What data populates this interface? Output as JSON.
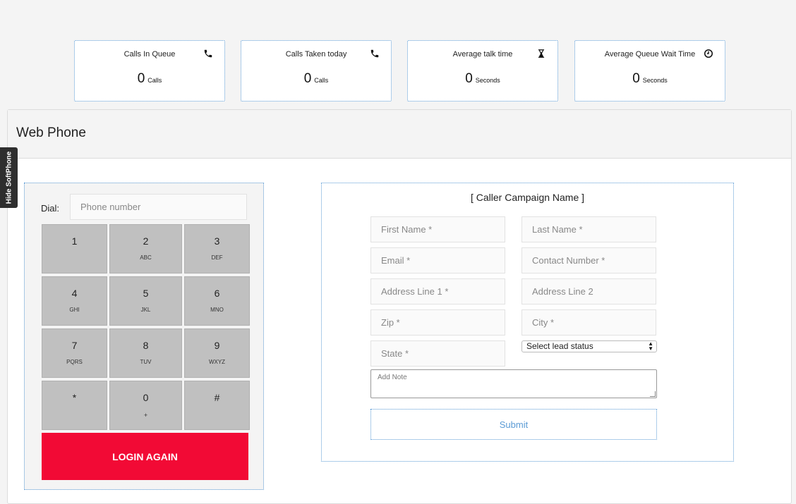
{
  "stats": [
    {
      "label": "Calls In Queue",
      "value": "0",
      "unit": "Calls",
      "icon": "phone-icon"
    },
    {
      "label": "Calls Taken today",
      "value": "0",
      "unit": "Calls",
      "icon": "phone-icon"
    },
    {
      "label": "Average talk time",
      "value": "0",
      "unit": "Seconds",
      "icon": "hourglass-icon"
    },
    {
      "label": "Average Queue Wait Time",
      "value": "0",
      "unit": "Seconds",
      "icon": "clock-icon"
    }
  ],
  "side_tab": {
    "label": "Hide SoftPhone"
  },
  "panel": {
    "title": "Web Phone"
  },
  "dialer": {
    "label": "Dial:",
    "placeholder": "Phone number",
    "keys": [
      {
        "digit": "1",
        "letters": ""
      },
      {
        "digit": "2",
        "letters": "ABC"
      },
      {
        "digit": "3",
        "letters": "DEF"
      },
      {
        "digit": "4",
        "letters": "GHI"
      },
      {
        "digit": "5",
        "letters": "JKL"
      },
      {
        "digit": "6",
        "letters": "MNO"
      },
      {
        "digit": "7",
        "letters": "PQRS"
      },
      {
        "digit": "8",
        "letters": "TUV"
      },
      {
        "digit": "9",
        "letters": "WXYZ"
      },
      {
        "digit": "*",
        "letters": ""
      },
      {
        "digit": "0",
        "letters": "+"
      },
      {
        "digit": "#",
        "letters": ""
      }
    ],
    "login_label": "LOGIN AGAIN",
    "login_color": "#f20a35"
  },
  "form": {
    "campaign": "[ Caller Campaign Name ]",
    "first_name": "First Name *",
    "last_name": "Last Name *",
    "email": "Email *",
    "contact_number": "Contact Number *",
    "address1": "Address Line 1 *",
    "address2": "Address Line 2",
    "zip": "Zip *",
    "city": "City *",
    "state": "State *",
    "lead_status": "Select lead status",
    "note": "Add Note",
    "submit": "Submit"
  },
  "colors": {
    "accent": "#5b9bd5",
    "key": "#c0c0c0",
    "background": "#f4f4f4"
  }
}
